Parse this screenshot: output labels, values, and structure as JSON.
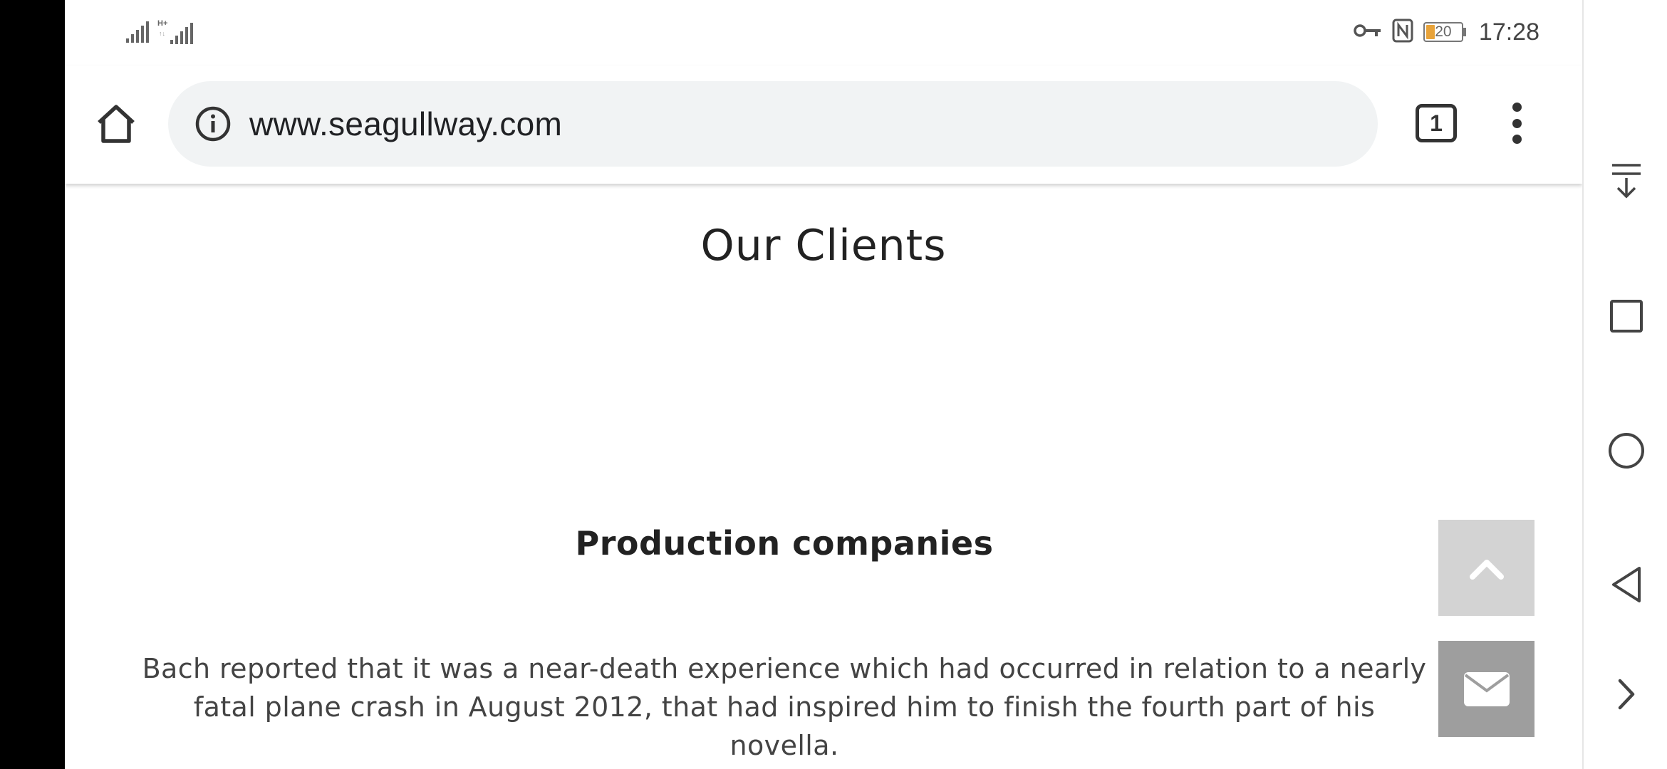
{
  "status_bar": {
    "time": "17:28",
    "battery_level": "20",
    "icons": [
      "signal-icon",
      "hplus-signal-icon",
      "key-icon",
      "nfc-icon",
      "battery-icon"
    ]
  },
  "browser": {
    "url": "www.seagullway.com",
    "tab_count": "1",
    "icons": [
      "home-icon",
      "info-icon",
      "tabs-icon",
      "more-vert-icon"
    ]
  },
  "page": {
    "section_title": "Our Clients",
    "subsection_title": "Production companies",
    "paragraph": "Bach reported that it was a near-death experience which had occurred in relation to a nearly fatal plane crash in August 2012, that had inspired him to finish the fourth part of his novella.",
    "floating_buttons": [
      "chevron-up-icon",
      "mail-icon"
    ]
  },
  "navigation_bar": {
    "icons": [
      "notification-pulldown-icon",
      "recents-icon",
      "home-circle-icon",
      "back-icon",
      "expand-right-icon"
    ]
  },
  "colors": {
    "url_bar_bg": "#f1f3f4",
    "scroll_top_bg": "#d3d3d3",
    "contact_bg": "#9e9e9e",
    "battery_fill": "#e8a33a"
  }
}
